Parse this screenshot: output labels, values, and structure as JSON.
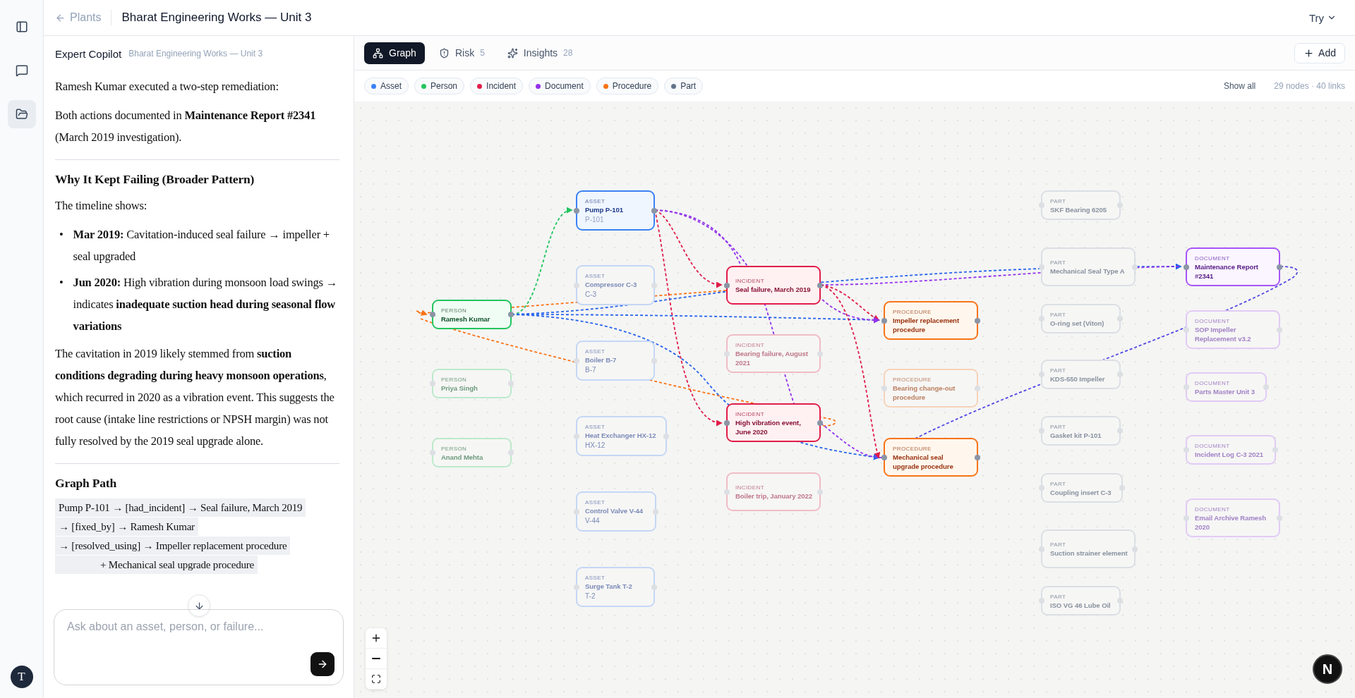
{
  "header": {
    "back_link": "Plants",
    "title": "Bharat Engineering Works — Unit 3",
    "try_menu": "Try"
  },
  "rail": {
    "nav": [
      {
        "kind": "chat",
        "selected": false
      },
      {
        "kind": "files",
        "selected": true
      }
    ],
    "avatar": "T"
  },
  "chat": {
    "title": "Expert Copilot",
    "subtitle": "Bharat Engineering Works — Unit 3",
    "blocks": [
      {
        "kind": "paragraph",
        "text": "Ramesh Kumar executed a two-step remediation:"
      },
      {
        "kind": "paragraph",
        "text": "Both actions documented in **Maintenance Report #2341** (March 2019 investigation)."
      },
      {
        "kind": "rule"
      },
      {
        "kind": "heading",
        "text": "Why It Kept Failing (Broader Pattern)"
      },
      {
        "kind": "paragraph",
        "text": "The timeline shows:"
      },
      {
        "kind": "bullets",
        "marker": "•",
        "items": [
          "**Mar 2019:** Cavitation-induced seal failure → impeller + seal upgraded",
          "**Jun 2020:** High vibration during monsoon load swings → indicates **inadequate suction head during seasonal flow variations**"
        ]
      },
      {
        "kind": "paragraph",
        "text": "The cavitation in 2019 likely stemmed from **suction conditions degrading during heavy monsoon operations**, which recurred in 2020 as a vibration event. This suggests the root cause (intake line restrictions or NPSH margin) was not fully resolved by the 2019 seal upgrade alone."
      },
      {
        "kind": "rule"
      },
      {
        "kind": "heading",
        "text": "Graph Path"
      },
      {
        "kind": "path",
        "items": [
          {
            "text": "Pump P-101 → [had_incident] → Seal failure, March 2019",
            "indent": false
          },
          {
            "text": "→ [fixed_by] → Ramesh Kumar",
            "indent": false
          },
          {
            "text": "→ [resolved_using] → Impeller replacement procedure",
            "indent": false
          },
          {
            "text": "+ Mechanical seal upgrade procedure",
            "indent": true
          }
        ]
      }
    ],
    "input": {
      "placeholder": "Ask about an asset, person, or failure..."
    }
  },
  "graph": {
    "tabs": [
      {
        "kind": "graph",
        "label": "Graph",
        "selected": true
      },
      {
        "kind": "risk",
        "label": "Risk",
        "count": "5",
        "selected": false
      },
      {
        "kind": "insights",
        "label": "Insights",
        "count": "28",
        "selected": false
      }
    ],
    "add_button": "Add",
    "legend": [
      {
        "label": "Asset",
        "color": "#3b82f6"
      },
      {
        "label": "Person",
        "color": "#22c55e"
      },
      {
        "label": "Incident",
        "color": "#e11d48"
      },
      {
        "label": "Document",
        "color": "#9333ea"
      },
      {
        "label": "Procedure",
        "color": "#f97316"
      },
      {
        "label": "Part",
        "color": "#64748b"
      }
    ],
    "show_all": "Show all",
    "stats": "29 nodes · 40 links",
    "nodes": [
      {
        "kind": "asset",
        "category": "ASSET",
        "name": "Pump P-101",
        "code": "P-101",
        "highlighted": true
      },
      {
        "kind": "asset",
        "category": "ASSET",
        "name": "Compressor C-3",
        "code": "C-3",
        "highlighted": false
      },
      {
        "kind": "asset",
        "category": "ASSET",
        "name": "Boiler B-7",
        "code": "B-7",
        "highlighted": false
      },
      {
        "kind": "asset",
        "category": "ASSET",
        "name": "Heat Exchanger HX-12",
        "code": "HX-12",
        "highlighted": false
      },
      {
        "kind": "asset",
        "category": "ASSET",
        "name": "Control Valve V-44",
        "code": "V-44",
        "highlighted": false
      },
      {
        "kind": "asset",
        "category": "ASSET",
        "name": "Surge Tank T-2",
        "code": "T-2",
        "highlighted": false
      },
      {
        "kind": "person",
        "category": "PERSON",
        "name": "Ramesh Kumar",
        "highlighted": true
      },
      {
        "kind": "person",
        "category": "PERSON",
        "name": "Priya Singh",
        "highlighted": false
      },
      {
        "kind": "person",
        "category": "PERSON",
        "name": "Anand Mehta",
        "highlighted": false
      },
      {
        "kind": "incident",
        "category": "INCIDENT",
        "name": "Seal failure, March 2019",
        "highlighted": true
      },
      {
        "kind": "incident",
        "category": "INCIDENT",
        "name": "Bearing failure, August 2021",
        "highlighted": false
      },
      {
        "kind": "incident",
        "category": "INCIDENT",
        "name": "High vibration event, June 2020",
        "highlighted": true
      },
      {
        "kind": "incident",
        "category": "INCIDENT",
        "name": "Boiler trip, January 2022",
        "highlighted": false
      },
      {
        "kind": "procedure",
        "category": "PROCEDURE",
        "name": "Impeller replacement procedure",
        "highlighted": true
      },
      {
        "kind": "procedure",
        "category": "PROCEDURE",
        "name": "Bearing change-out procedure",
        "highlighted": false
      },
      {
        "kind": "procedure",
        "category": "PROCEDURE",
        "name": "Mechanical seal upgrade procedure",
        "highlighted": true
      },
      {
        "kind": "part",
        "category": "PART",
        "name": "SKF Bearing 6205",
        "highlighted": false
      },
      {
        "kind": "part",
        "category": "PART",
        "name": "Mechanical Seal Type A",
        "highlighted": false
      },
      {
        "kind": "part",
        "category": "PART",
        "name": "O-ring set (Viton)",
        "highlighted": false
      },
      {
        "kind": "part",
        "category": "PART",
        "name": "KDS-550 Impeller",
        "highlighted": false
      },
      {
        "kind": "part",
        "category": "PART",
        "name": "Gasket kit P-101",
        "highlighted": false
      },
      {
        "kind": "part",
        "category": "PART",
        "name": "Coupling insert C-3",
        "highlighted": false
      },
      {
        "kind": "part",
        "category": "PART",
        "name": "Suction strainer element",
        "highlighted": false
      },
      {
        "kind": "part",
        "category": "PART",
        "name": "ISO VG 46 Lube Oil",
        "highlighted": false
      },
      {
        "kind": "document",
        "category": "DOCUMENT",
        "name": "Maintenance Report #2341",
        "highlighted": true
      },
      {
        "kind": "document",
        "category": "DOCUMENT",
        "name": "SOP Impeller Replacement v3.2",
        "highlighted": false
      },
      {
        "kind": "document",
        "category": "DOCUMENT",
        "name": "Parts Master Unit 3",
        "highlighted": false
      },
      {
        "kind": "document",
        "category": "DOCUMENT",
        "name": "Incident Log C-3 2021",
        "highlighted": false
      },
      {
        "kind": "document",
        "category": "DOCUMENT",
        "name": "Email Archive Ramesh 2020",
        "highlighted": false
      }
    ],
    "dev_badge": "N"
  }
}
